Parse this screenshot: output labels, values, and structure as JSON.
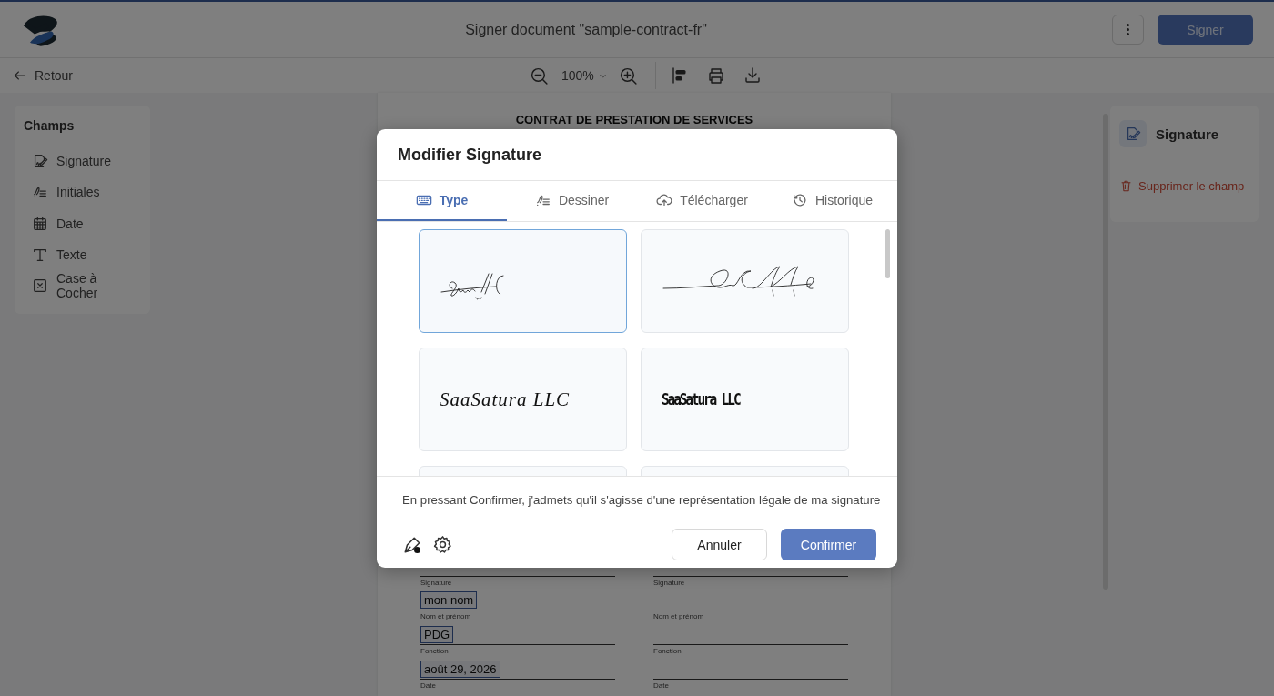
{
  "header": {
    "title": "Signer document \"sample-contract-fr\"",
    "sign_button": "Signer"
  },
  "toolbar": {
    "back": "Retour",
    "zoom": "100%"
  },
  "fields_panel": {
    "title": "Champs",
    "items": [
      {
        "label": "Signature",
        "kind": "signature"
      },
      {
        "label": "Initiales",
        "kind": "initials"
      },
      {
        "label": "Date",
        "kind": "date"
      },
      {
        "label": "Texte",
        "kind": "text"
      },
      {
        "label": "Case à Cocher",
        "kind": "checkbox"
      }
    ]
  },
  "document": {
    "heading": "CONTRAT DE PRESTATION DE SERVICES",
    "columns": [
      {
        "rows": [
          {
            "label": "Signature"
          },
          {
            "value": "mon nom",
            "label": "Nom et prénom"
          },
          {
            "value": "PDG",
            "label": "Fonction"
          },
          {
            "value": "août 29, 2026",
            "label": "Date"
          }
        ]
      },
      {
        "rows": [
          {
            "label": "Signature"
          },
          {
            "label": "Nom et prénom"
          },
          {
            "label": "Fonction"
          },
          {
            "label": "Date"
          }
        ]
      }
    ]
  },
  "properties_panel": {
    "title": "Signature",
    "delete": "Supprimer le champ"
  },
  "dialog": {
    "title": "Modifier Signature",
    "tabs": [
      {
        "label": "Type",
        "kind": "keyboard",
        "selected": true
      },
      {
        "label": "Dessiner",
        "kind": "draw",
        "selected": false
      },
      {
        "label": "Télécharger",
        "kind": "upload",
        "selected": false
      },
      {
        "label": "Historique",
        "kind": "history",
        "selected": false
      }
    ],
    "options": [
      {
        "kind": "compact-scribble",
        "selected": true
      },
      {
        "kind": "wide-scribble",
        "selected": false
      },
      {
        "kind": "script",
        "text": "SaaSatura LLC",
        "selected": false
      },
      {
        "kind": "print",
        "text": "SaaSatura LLC",
        "selected": false
      },
      {
        "kind": "blank",
        "selected": false
      },
      {
        "kind": "blank",
        "selected": false
      }
    ],
    "notice": "En pressant Confirmer, j'admets qu'il s'agisse d'une représentation légale de ma signature",
    "cancel": "Annuler",
    "confirm": "Confirmer"
  }
}
